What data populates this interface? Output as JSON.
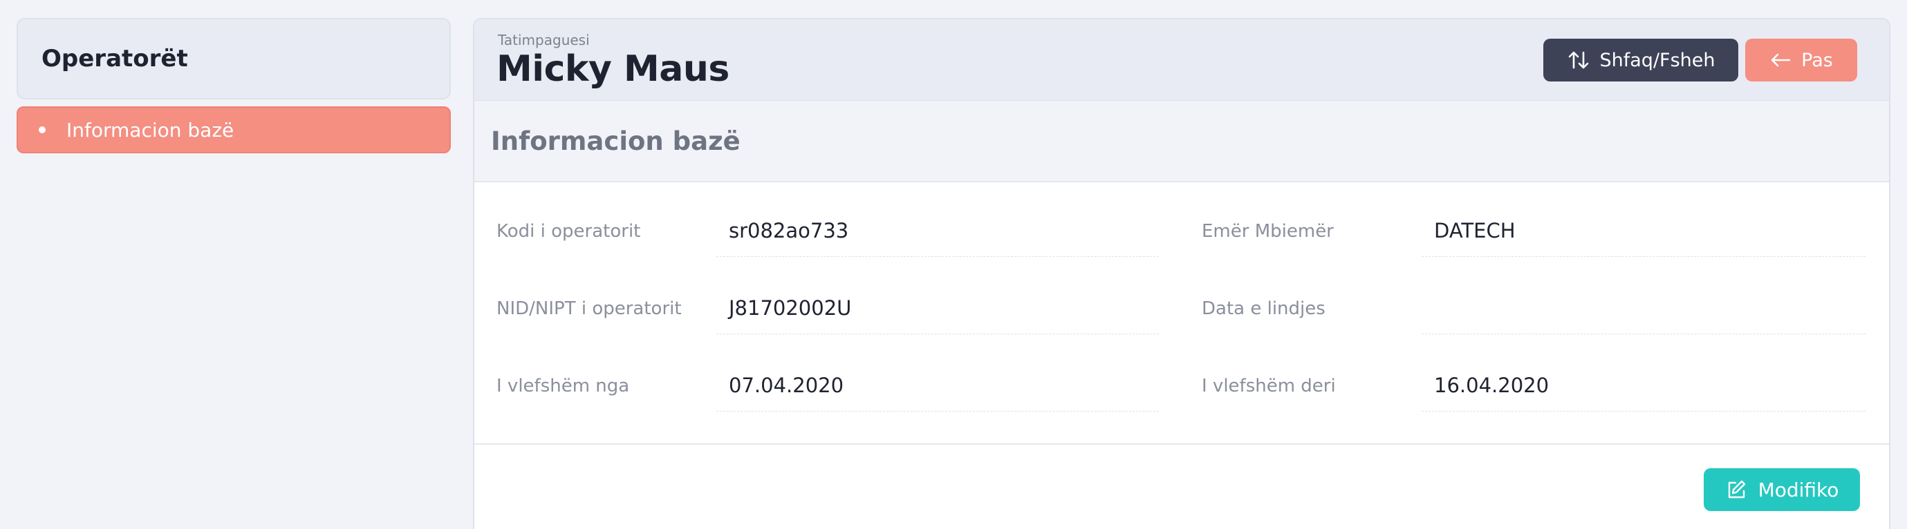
{
  "sidebar": {
    "title": "Operatorët",
    "items": [
      {
        "label": "Informacion bazë",
        "active": true
      }
    ]
  },
  "header": {
    "subtitle": "Tatimpaguesi",
    "title": "Micky Maus",
    "toggle_label": "Shfaq/Fsheh",
    "back_label": "Pas"
  },
  "section": {
    "title": "Informacion bazë"
  },
  "fields": {
    "operator_code": {
      "label": "Kodi i operatorit",
      "value": "sr082ao733"
    },
    "full_name": {
      "label": "Emër Mbiemër",
      "value": "DATECH"
    },
    "nid": {
      "label": "NID/NIPT i operatorit",
      "value": "J81702002U"
    },
    "birth_date": {
      "label": "Data e lindjes",
      "value": ""
    },
    "valid_from": {
      "label": "I vlefshëm nga",
      "value": "07.04.2020"
    },
    "valid_to": {
      "label": "I vlefshëm deri",
      "value": "16.04.2020"
    }
  },
  "actions": {
    "edit_label": "Modifiko"
  },
  "colors": {
    "accent_salmon": "#f48f82",
    "dark_button": "#3e4257",
    "teal_button": "#25c8c0"
  }
}
